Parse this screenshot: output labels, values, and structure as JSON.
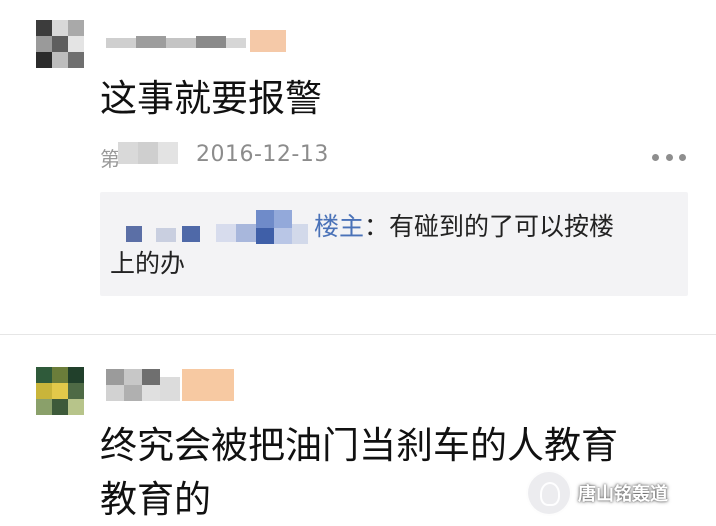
{
  "comments": [
    {
      "text": "这事就要报警",
      "meta_prefix": "第",
      "date": "2016-12-13",
      "reply": {
        "author": "楼主",
        "separator": "：",
        "line1": "有碰到的了可以按楼",
        "line2": "上的办"
      }
    },
    {
      "text_line1": "终究会被把油门当刹车的人教育",
      "text_line2": "教育的"
    }
  ],
  "watermark": {
    "text": "唐山铭轰道",
    "icon": "brand-logo-icon"
  },
  "colors": {
    "reply_author": "#4a72b8",
    "reply_background": "#f3f3f5",
    "date": "#8c8c8c"
  }
}
